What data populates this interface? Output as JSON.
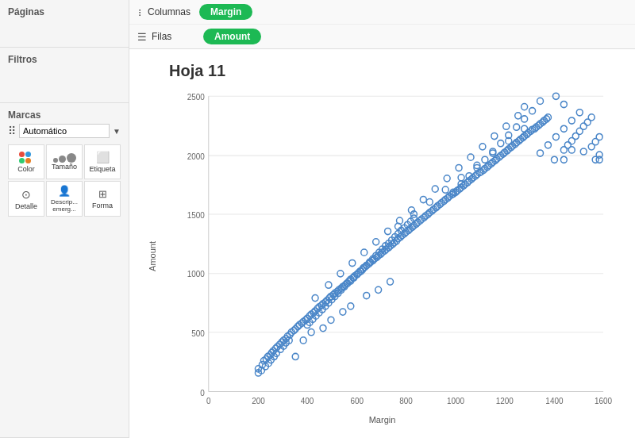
{
  "sidebar": {
    "paginas_label": "Páginas",
    "filtros_label": "Filtros",
    "marcas_label": "Marcas",
    "automatico_label": "Automático",
    "marks": [
      {
        "id": "color",
        "label": "Color"
      },
      {
        "id": "tamano",
        "label": "Tamaño"
      },
      {
        "id": "etiqueta",
        "label": "Etiqueta"
      },
      {
        "id": "detalle",
        "label": "Detalle"
      },
      {
        "id": "descrip",
        "label": "Descrip...emerg..."
      },
      {
        "id": "forma",
        "label": "Forma"
      }
    ]
  },
  "topbar": {
    "columnas_label": "Columnas",
    "filas_label": "Filas",
    "columnas_pill": "Margin",
    "filas_pill": "Amount"
  },
  "chart": {
    "title": "Hoja 11",
    "x_axis_label": "Margin",
    "y_axis_label": "Amount",
    "x_ticks": [
      "0",
      "200",
      "400",
      "600",
      "800",
      "1000",
      "1200",
      "1400",
      "1600"
    ],
    "y_ticks": [
      "0",
      "500",
      "1000",
      "1500",
      "2000",
      "2500"
    ],
    "accent_color": "#4a86c8"
  }
}
